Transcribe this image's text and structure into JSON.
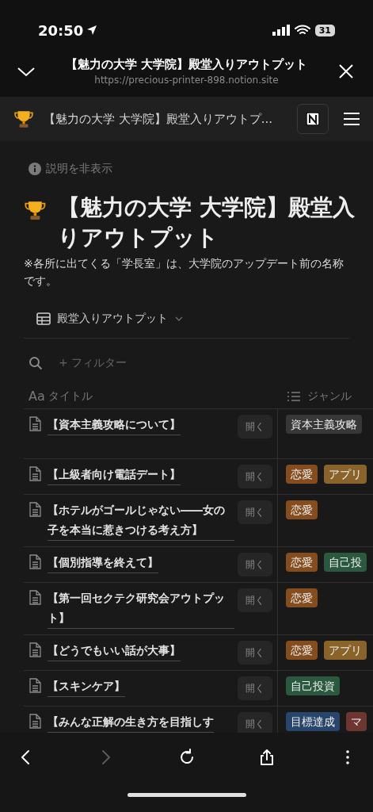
{
  "status_bar": {
    "time": "20:50",
    "battery": "31"
  },
  "browser_header": {
    "title": "【魅力の大学 大学院】殿堂入りアウトプット",
    "url": "https://precious-printer-898.notion.site"
  },
  "notion_bar": {
    "title": "【魅力の大学 大学院】殿堂入りアウトプ..."
  },
  "description_toggle": "説明を非表示",
  "page": {
    "title": "【魅力の大学 大学院】殿堂入りアウトプット",
    "description": "※各所に出てくる「学長室」は、大学院のアップデート前の名称です。"
  },
  "view": {
    "label": "殿堂入りアウトプット"
  },
  "filter": {
    "label": "+ フィルター"
  },
  "table": {
    "columns": [
      {
        "label": "タイトル",
        "prefix": "Aa"
      },
      {
        "label": "ジャンル"
      }
    ],
    "rows": [
      {
        "title": "【資本主義攻略について】",
        "open": "開く",
        "tags": [
          {
            "label": "資本主義攻略",
            "color": "#373737"
          }
        ]
      },
      {
        "title": "【上級者向け電話デート】",
        "open": "開く",
        "tags": [
          {
            "label": "恋愛",
            "color": "#854c1d"
          },
          {
            "label": "アプリ",
            "color": "#89632a"
          }
        ]
      },
      {
        "title": "【ホテルがゴールじゃない――女の子を本当に惹きつける考え方】",
        "open": "開く",
        "tags": [
          {
            "label": "恋愛",
            "color": "#854c1d"
          }
        ]
      },
      {
        "title": "【個別指導を終えて】",
        "open": "開く",
        "tags": [
          {
            "label": "恋愛",
            "color": "#854c1d"
          },
          {
            "label": "自己投",
            "color": "#2b593f"
          }
        ]
      },
      {
        "title": "【第一回セクテク研究会アウトプット】",
        "open": "開く",
        "tags": [
          {
            "label": "恋愛",
            "color": "#854c1d"
          }
        ]
      },
      {
        "title": "【どうでもいい話が大事】",
        "open": "開く",
        "tags": [
          {
            "label": "恋愛",
            "color": "#854c1d"
          },
          {
            "label": "アプリ",
            "color": "#89632a"
          }
        ]
      },
      {
        "title": "【スキンケア】",
        "open": "開く",
        "tags": [
          {
            "label": "自己投資",
            "color": "#2b593f"
          }
        ]
      },
      {
        "title": "【みんな正解の生き方を目指しす",
        "open": "開く",
        "tags": [
          {
            "label": "目標達成",
            "color": "#28456c"
          },
          {
            "label": "マ",
            "color": "#6e3630"
          }
        ]
      }
    ]
  },
  "toolbar": [
    {
      "kind": "back",
      "disabled": false
    },
    {
      "kind": "forward",
      "disabled": true
    },
    {
      "kind": "reload",
      "disabled": false
    },
    {
      "kind": "share",
      "disabled": false
    },
    {
      "kind": "more",
      "disabled": false
    }
  ]
}
